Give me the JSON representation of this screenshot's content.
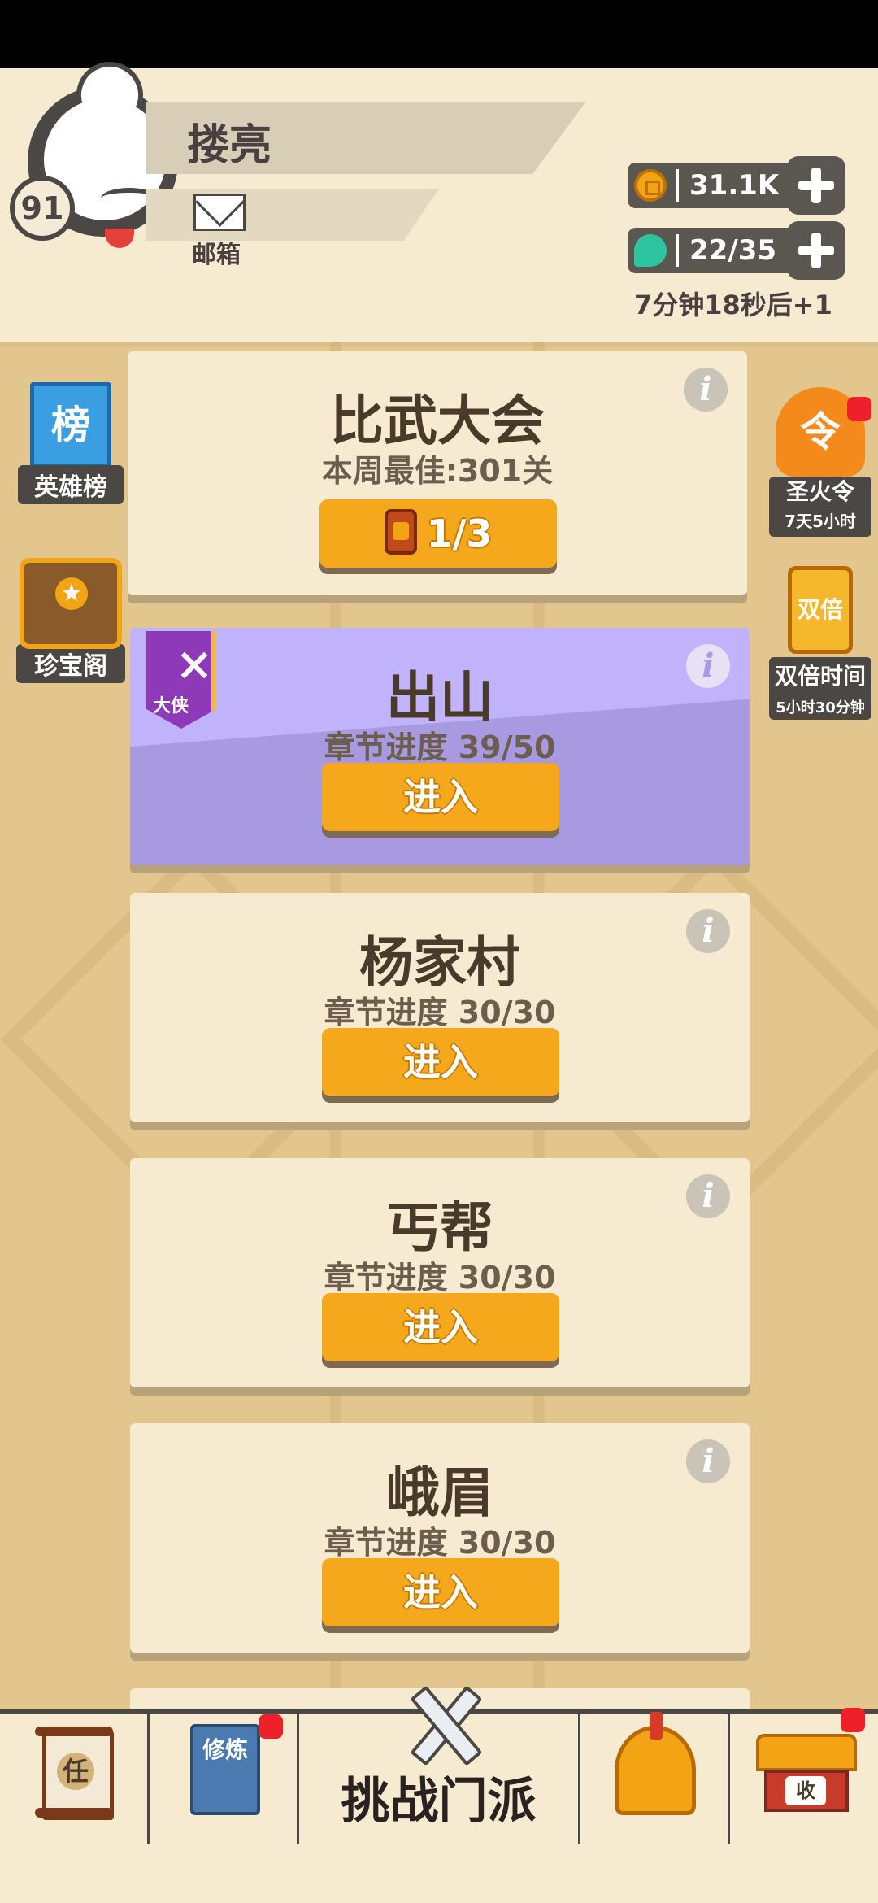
{
  "player": {
    "name": "搂亮",
    "level": "91",
    "mail_label": "邮箱"
  },
  "resources": {
    "coins": "31.1K",
    "stamina": "22/35",
    "stamina_timer": "7分钟18秒后+1"
  },
  "sidebar_left": [
    {
      "icon_text": "榜",
      "label": "英雄榜"
    },
    {
      "label": "珍宝阁"
    }
  ],
  "sidebar_right": [
    {
      "icon_text": "令",
      "label": "圣火令",
      "sub": "7天5小时"
    },
    {
      "icon_text": "双倍",
      "label": "双倍时间",
      "sub": "5小时30分钟"
    }
  ],
  "cards": [
    {
      "title": "比武大会",
      "subtitle": "本周最佳:301关",
      "button": "1/3"
    },
    {
      "title": "出山",
      "subtitle": "章节进度 39/50",
      "button": "进入",
      "badge": "大侠"
    },
    {
      "title": "杨家村",
      "subtitle": "章节进度 30/30",
      "button": "进入"
    },
    {
      "title": "丐帮",
      "subtitle": "章节进度 30/30",
      "button": "进入"
    },
    {
      "title": "峨眉",
      "subtitle": "章节进度 30/30",
      "button": "进入"
    }
  ],
  "info_glyph": "i",
  "bottom_nav": {
    "task_glyph": "任",
    "train_glyph": "修炼",
    "challenge_label": "挑战门派",
    "shop_glyph": "收"
  },
  "colors": {
    "accent_button": "#f5a81c",
    "card_bg": "#f6ead1",
    "highlight_card": "#c1b3fb",
    "notification": "#f0202a"
  }
}
